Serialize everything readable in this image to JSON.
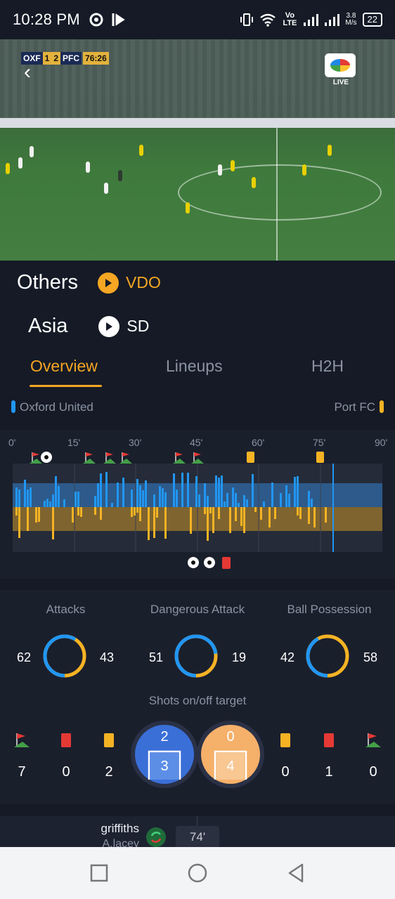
{
  "status_bar": {
    "time": "10:28 PM",
    "network_speed": "3.8",
    "network_speed_unit": "M/s",
    "network_label": "Vo LTE",
    "battery": "22",
    "icons": [
      "settings-icon",
      "media-icon",
      "vibrate-icon",
      "wifi-icon",
      "signal-icon",
      "signal-icon-2"
    ]
  },
  "video": {
    "scorebug": {
      "home": "OXF",
      "home_score": "1",
      "away_score": "2",
      "away": "PFC",
      "clock": "76:26"
    },
    "broadcaster_badge": "LIVE"
  },
  "streams": [
    {
      "label": "Others",
      "quality": "VDO",
      "accent": "#f5a623"
    },
    {
      "label": "Asia",
      "quality": "SD",
      "accent": "#ffffff"
    }
  ],
  "tabs": [
    {
      "label": "Overview",
      "active": true
    },
    {
      "label": "Lineups",
      "active": false
    },
    {
      "label": "H2H",
      "active": false
    }
  ],
  "teams": {
    "home": "Oxford United",
    "away": "Port FC",
    "home_color": "#2196f3",
    "away_color": "#f5b324"
  },
  "timeline": {
    "ticks": [
      "0'",
      "15'",
      "30'",
      "45'",
      "60'",
      "75'",
      "90'"
    ],
    "current_minute": 76
  },
  "stats": {
    "attacks": {
      "label": "Attacks",
      "home": "62",
      "away": "43",
      "home_share": 0.59
    },
    "dangerous_attack": {
      "label": "Dangerous Attack",
      "home": "51",
      "away": "19",
      "home_share": 0.73
    },
    "ball_possession": {
      "label": "Ball Possession",
      "home": "42",
      "away": "58",
      "home_share": 0.42
    },
    "shots_title": "Shots on/off target",
    "home": {
      "corners": "7",
      "red_cards": "0",
      "yellow_cards": "2",
      "shots_on": "2",
      "shots_off": "3"
    },
    "away": {
      "shots_on": "0",
      "shots_off": "4",
      "yellow_cards": "0",
      "red_cards": "1",
      "corners": "0"
    }
  },
  "substitution": {
    "player_in": "griffiths",
    "player_out": "A.lacey",
    "minute": "74'"
  },
  "nav": {
    "buttons": [
      "recent-apps",
      "home",
      "back"
    ]
  }
}
